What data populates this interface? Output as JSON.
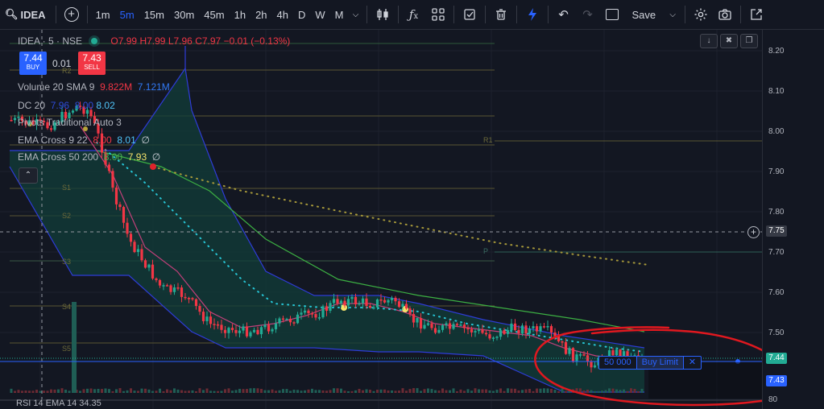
{
  "toolbar": {
    "symbol": "IDEA",
    "timeframes": [
      "1m",
      "5m",
      "15m",
      "30m",
      "45m",
      "1h",
      "2h",
      "4h",
      "D",
      "W",
      "M"
    ],
    "active_timeframe": "5m",
    "save_label": "Save"
  },
  "legend": {
    "title": "IDEA · 5 · NSE",
    "ohlc": {
      "o": "O7.99",
      "h": "H7.99",
      "l": "L7.96",
      "c": "C7.97",
      "chg": "−0.01 (−0.13%)"
    },
    "buy_price": "7.44",
    "buy_label": "BUY",
    "sell_price": "7.43",
    "sell_label": "SELL",
    "spread": "0.01",
    "volume": {
      "label": "Volume 20 SMA 9",
      "v1": "9.822M",
      "v2": "7.121M"
    },
    "dc": {
      "label": "DC 20",
      "v1": "7.96",
      "v2": "8.00",
      "v3": "8.02"
    },
    "pivots": {
      "label": "Pivots Traditional Auto 3"
    },
    "ema1": {
      "label": "EMA Cross 9 22",
      "v1": "8.00",
      "v2": "8.01",
      "v3": "∅"
    },
    "ema2": {
      "label": "EMA Cross 50 200",
      "v1": "8.00",
      "v2": "7.93",
      "v3": "∅"
    }
  },
  "price_axis": {
    "ticks": [
      "8.20",
      "8.10",
      "8.00",
      "7.90",
      "7.80",
      "7.70",
      "7.60",
      "7.50"
    ],
    "crosshair_price": "7.75",
    "bid_label": "7.44",
    "ask_label": "7.43",
    "bottom_tick": "80"
  },
  "pivot_labels": {
    "r1": "R1",
    "p": "P",
    "s1": "S1",
    "s2": "S2",
    "s3": "S3",
    "r2": "R2",
    "s4": "S4",
    "s5": "S5"
  },
  "order_line": {
    "qty": "50 000",
    "type": "Buy Limit",
    "close": "✕"
  },
  "bottom_indicator": "RSI 14 EMA 14  34.35",
  "colors": {
    "up": "#22ab94",
    "down": "#f23645",
    "accent": "#2962ff",
    "annotation": "#e0181f"
  }
}
